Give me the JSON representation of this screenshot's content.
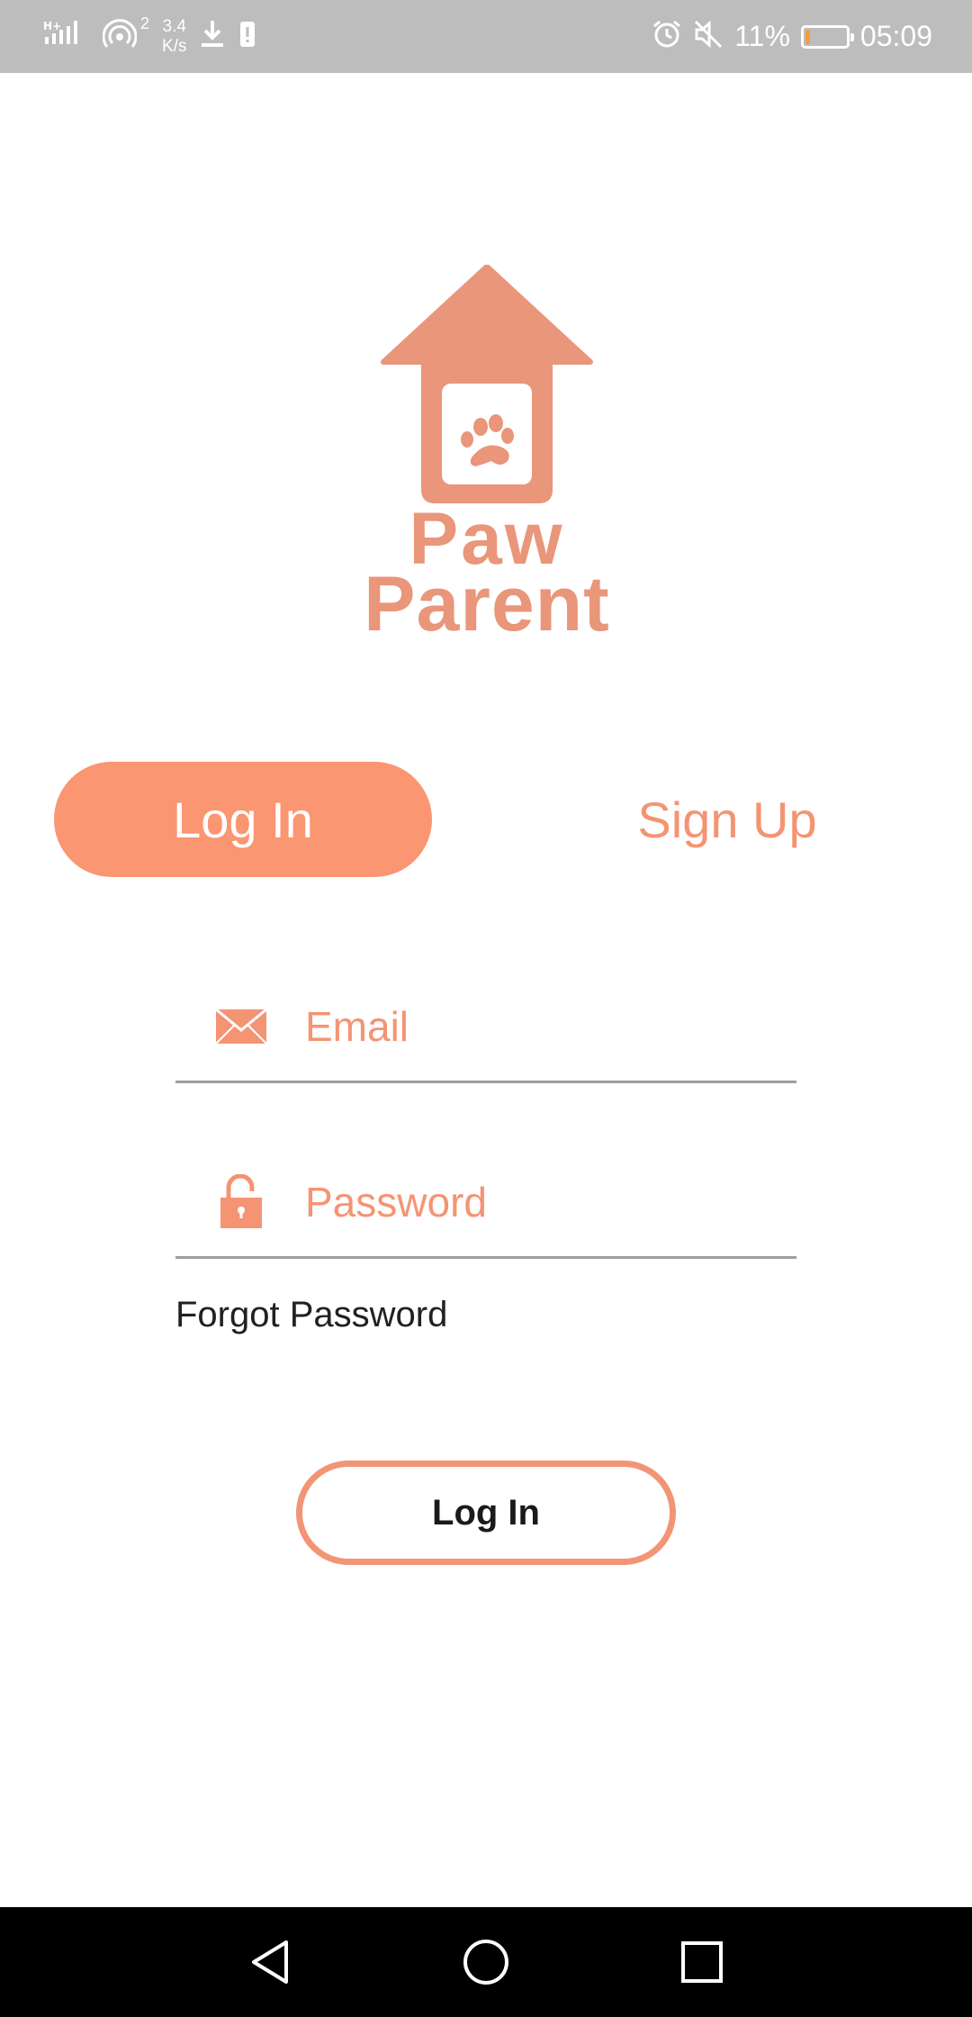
{
  "status_bar": {
    "network_label": "H+",
    "hotspot_count": "2",
    "speed_value": "3.4",
    "speed_unit": "K/s",
    "battery_percent": "11%",
    "battery_level": 0.11,
    "time": "05:09",
    "icons": [
      "signal-icon",
      "hotspot-icon",
      "download-icon",
      "sim-alert-icon",
      "alarm-icon",
      "mute-icon",
      "battery-icon"
    ]
  },
  "logo": {
    "word1": "Paw",
    "word2": "Parent",
    "color": "#e9967a"
  },
  "tabs": {
    "login_label": "Log In",
    "signup_label": "Sign Up",
    "active": "login"
  },
  "form": {
    "email_placeholder": "Email",
    "email_value": "",
    "password_placeholder": "Password",
    "password_value": "",
    "forgot_label": "Forgot Password",
    "submit_label": "Log In"
  },
  "colors": {
    "accent": "#fa9672",
    "accent_text": "#f49473",
    "status_bar": "#bdbdbd",
    "nav_bar": "#000000"
  },
  "nav_bar": {
    "icons": [
      "back-icon",
      "home-icon",
      "recents-icon"
    ]
  }
}
